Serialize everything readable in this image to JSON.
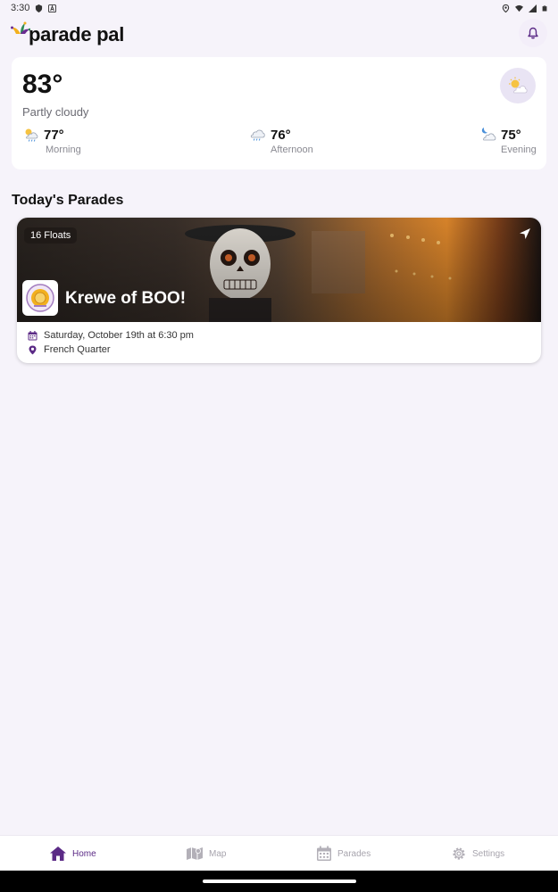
{
  "status_bar": {
    "time": "3:30"
  },
  "app": {
    "title": "parade pal"
  },
  "weather": {
    "current_temp": "83°",
    "condition": "Partly cloudy",
    "forecast": [
      {
        "period": "Morning",
        "temp": "77°",
        "icon": "sun-rain-icon"
      },
      {
        "period": "Afternoon",
        "temp": "76°",
        "icon": "rain-cloud-icon"
      },
      {
        "period": "Evening",
        "temp": "75°",
        "icon": "moon-cloud-icon"
      }
    ]
  },
  "section": {
    "title": "Today's Parades"
  },
  "parades": [
    {
      "floats": "16 Floats",
      "name": "Krewe of BOO!",
      "date": "Saturday, October 19th at 6:30 pm",
      "location": "French Quarter"
    }
  ],
  "nav": [
    {
      "label": "Home",
      "active": true,
      "icon": "home-icon"
    },
    {
      "label": "Map",
      "active": false,
      "icon": "map-icon"
    },
    {
      "label": "Parades",
      "active": false,
      "icon": "calendar-icon"
    },
    {
      "label": "Settings",
      "active": false,
      "icon": "gear-icon"
    }
  ],
  "colors": {
    "accent": "#5b2a86",
    "background": "#f6f3fa"
  }
}
